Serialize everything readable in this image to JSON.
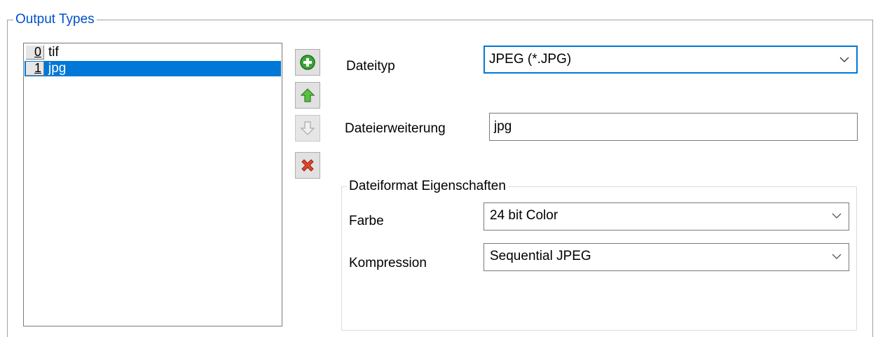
{
  "output_types": {
    "title": "Output Types",
    "list": [
      {
        "index": "0",
        "label": "tif",
        "selected": false
      },
      {
        "index": "1",
        "label": "jpg",
        "selected": true
      }
    ],
    "toolbar": {
      "add_icon": "green-plus-circle-icon",
      "up_icon": "green-up-arrow-icon",
      "down_icon": "gray-down-arrow-icon",
      "delete_icon": "red-x-icon"
    }
  },
  "file_settings": {
    "dateityp_label": "Dateityp",
    "dateityp_value": "JPEG (*.JPG)",
    "extension_label": "Dateierweiterung",
    "extension_value": "jpg"
  },
  "format_properties": {
    "title": "Dateiformat Eigenschaften",
    "color_label": "Farbe",
    "color_value": "24 bit Color",
    "compression_label": "Kompression",
    "compression_value": "Sequential JPEG"
  },
  "colors": {
    "accent": "#0078d7",
    "title_blue": "#0050c8"
  }
}
